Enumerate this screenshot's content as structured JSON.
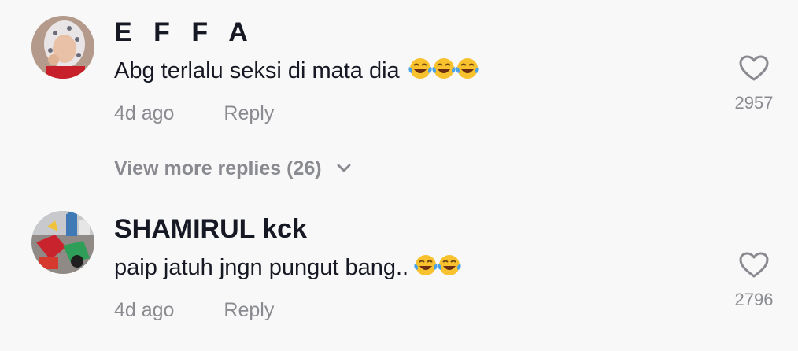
{
  "comments": [
    {
      "username": "E F F A",
      "text": "Abg terlalu seksi di mata dia",
      "emoji_count": 3,
      "emoji_name": "face-with-tears-of-joy",
      "time": "4d ago",
      "reply_label": "Reply",
      "likes": "2957",
      "view_more_replies": "View more replies (26)"
    },
    {
      "username": "SHAMIRUL kck",
      "text": "paip jatuh jngn pungut bang..",
      "emoji_count": 2,
      "emoji_name": "face-with-tears-of-joy",
      "time": "4d ago",
      "reply_label": "Reply",
      "likes": "2796"
    }
  ],
  "colors": {
    "background": "#f8f8f8",
    "primary_text": "#161823",
    "secondary_text": "#8a8b91"
  },
  "icons": {
    "like": "heart-outline-icon",
    "expand": "chevron-down-icon"
  }
}
